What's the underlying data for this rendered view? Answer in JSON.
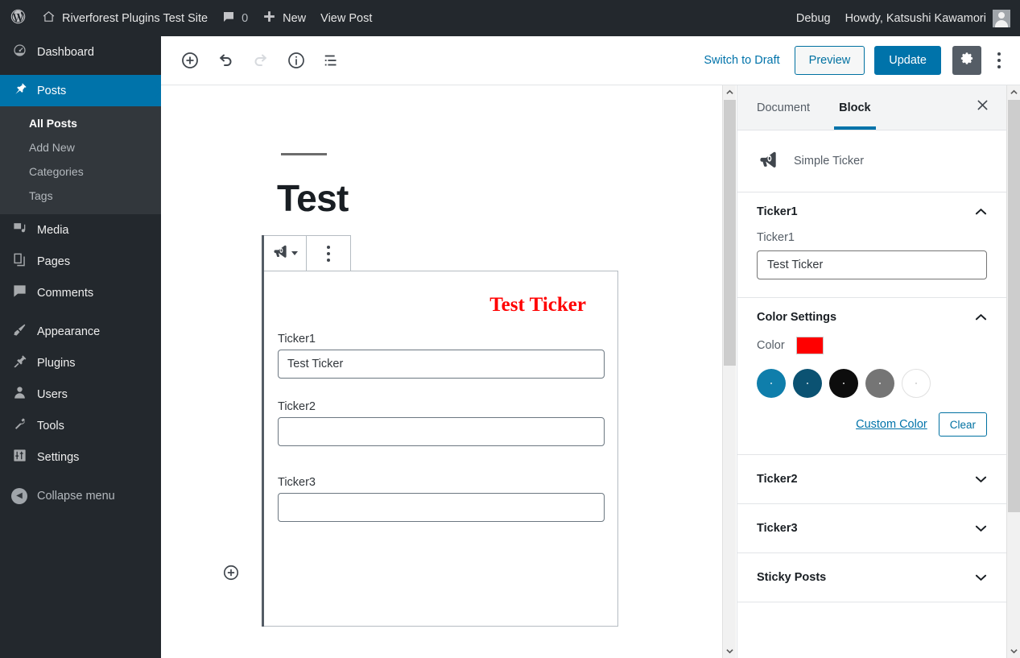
{
  "adminbar": {
    "logo_icon": "wordpress-logo-icon",
    "home_icon": "home-icon",
    "site_name": "Riverforest Plugins Test Site",
    "comments_icon": "comment-bubble-icon",
    "comments_count": "0",
    "new_icon": "plus-icon",
    "new_label": "New",
    "view_post_label": "View Post",
    "debug_label": "Debug",
    "howdy_label": "Howdy, Katsushi Kawamori",
    "avatar_icon": "user-avatar-icon"
  },
  "sidebar": {
    "items": [
      {
        "label": "Dashboard",
        "icon": "dashboard-icon",
        "current": false
      },
      {
        "label": "Posts",
        "icon": "pin-icon",
        "current": true
      },
      {
        "label": "Media",
        "icon": "media-icon",
        "current": false
      },
      {
        "label": "Pages",
        "icon": "pages-icon",
        "current": false
      },
      {
        "label": "Comments",
        "icon": "comment-bubble-icon",
        "current": false
      },
      {
        "label": "Appearance",
        "icon": "paintbrush-icon",
        "current": false
      },
      {
        "label": "Plugins",
        "icon": "plug-icon",
        "current": false
      },
      {
        "label": "Users",
        "icon": "user-icon",
        "current": false
      },
      {
        "label": "Tools",
        "icon": "wrench-icon",
        "current": false
      },
      {
        "label": "Settings",
        "icon": "sliders-icon",
        "current": false
      }
    ],
    "submenu": [
      {
        "label": "All Posts",
        "active": true
      },
      {
        "label": "Add New",
        "active": false
      },
      {
        "label": "Categories",
        "active": false
      },
      {
        "label": "Tags",
        "active": false
      }
    ],
    "collapse_label": "Collapse menu",
    "collapse_icon": "arrow-left-circle-icon"
  },
  "editor_header": {
    "tools": [
      {
        "name": "add-block-icon",
        "disabled": false
      },
      {
        "name": "undo-icon",
        "disabled": false
      },
      {
        "name": "redo-icon",
        "disabled": true
      },
      {
        "name": "info-icon",
        "disabled": false
      },
      {
        "name": "block-navigation-icon",
        "disabled": false
      }
    ],
    "switch_to_draft": "Switch to Draft",
    "preview_label": "Preview",
    "update_label": "Update",
    "settings_icon": "gear-icon",
    "more_icon": "kebab-menu-icon"
  },
  "canvas": {
    "post_title": "Test",
    "block_toolbar": {
      "block_type_icon": "megaphone-icon",
      "dropdown_icon": "chevron-down-icon",
      "more_options_icon": "kebab-menu-icon"
    },
    "block": {
      "preview_text": "Test Ticker",
      "preview_color": "#ff0000",
      "fields": [
        {
          "label": "Ticker1",
          "value": "Test Ticker"
        },
        {
          "label": "Ticker2",
          "value": ""
        },
        {
          "label": "Ticker3",
          "value": ""
        }
      ]
    },
    "add_block_icon": "plus-circle-icon"
  },
  "inspector": {
    "tabs": [
      {
        "label": "Document",
        "active": false
      },
      {
        "label": "Block",
        "active": true
      }
    ],
    "close_icon": "close-icon",
    "block_card": {
      "icon": "megaphone-icon",
      "name": "Simple Ticker"
    },
    "panels": [
      {
        "title": "Ticker1",
        "open": true
      },
      {
        "title": "Color Settings",
        "open": true
      },
      {
        "title": "Ticker2",
        "open": false
      },
      {
        "title": "Ticker3",
        "open": false
      },
      {
        "title": "Sticky Posts",
        "open": false
      }
    ],
    "ticker1": {
      "field_label": "Ticker1",
      "field_value": "Test Ticker"
    },
    "color_settings": {
      "color_label": "Color",
      "current_color": "#ff0000",
      "swatches": [
        {
          "name": "swatch-blue-light",
          "hex": "#0f7eab"
        },
        {
          "name": "swatch-blue-dark",
          "hex": "#0b5272"
        },
        {
          "name": "swatch-black",
          "hex": "#0d0d0d"
        },
        {
          "name": "swatch-gray",
          "hex": "#757575"
        },
        {
          "name": "swatch-white",
          "hex": "#ffffff"
        }
      ],
      "custom_color_label": "Custom Color",
      "clear_label": "Clear"
    }
  },
  "scrollbars": {
    "up_arrow_icon": "chevron-up-icon",
    "down_arrow_icon": "chevron-down-icon"
  },
  "theme": {
    "admin_dark": "#23282d",
    "accent_blue": "#0073aa",
    "submenu_bg": "#32373c"
  }
}
